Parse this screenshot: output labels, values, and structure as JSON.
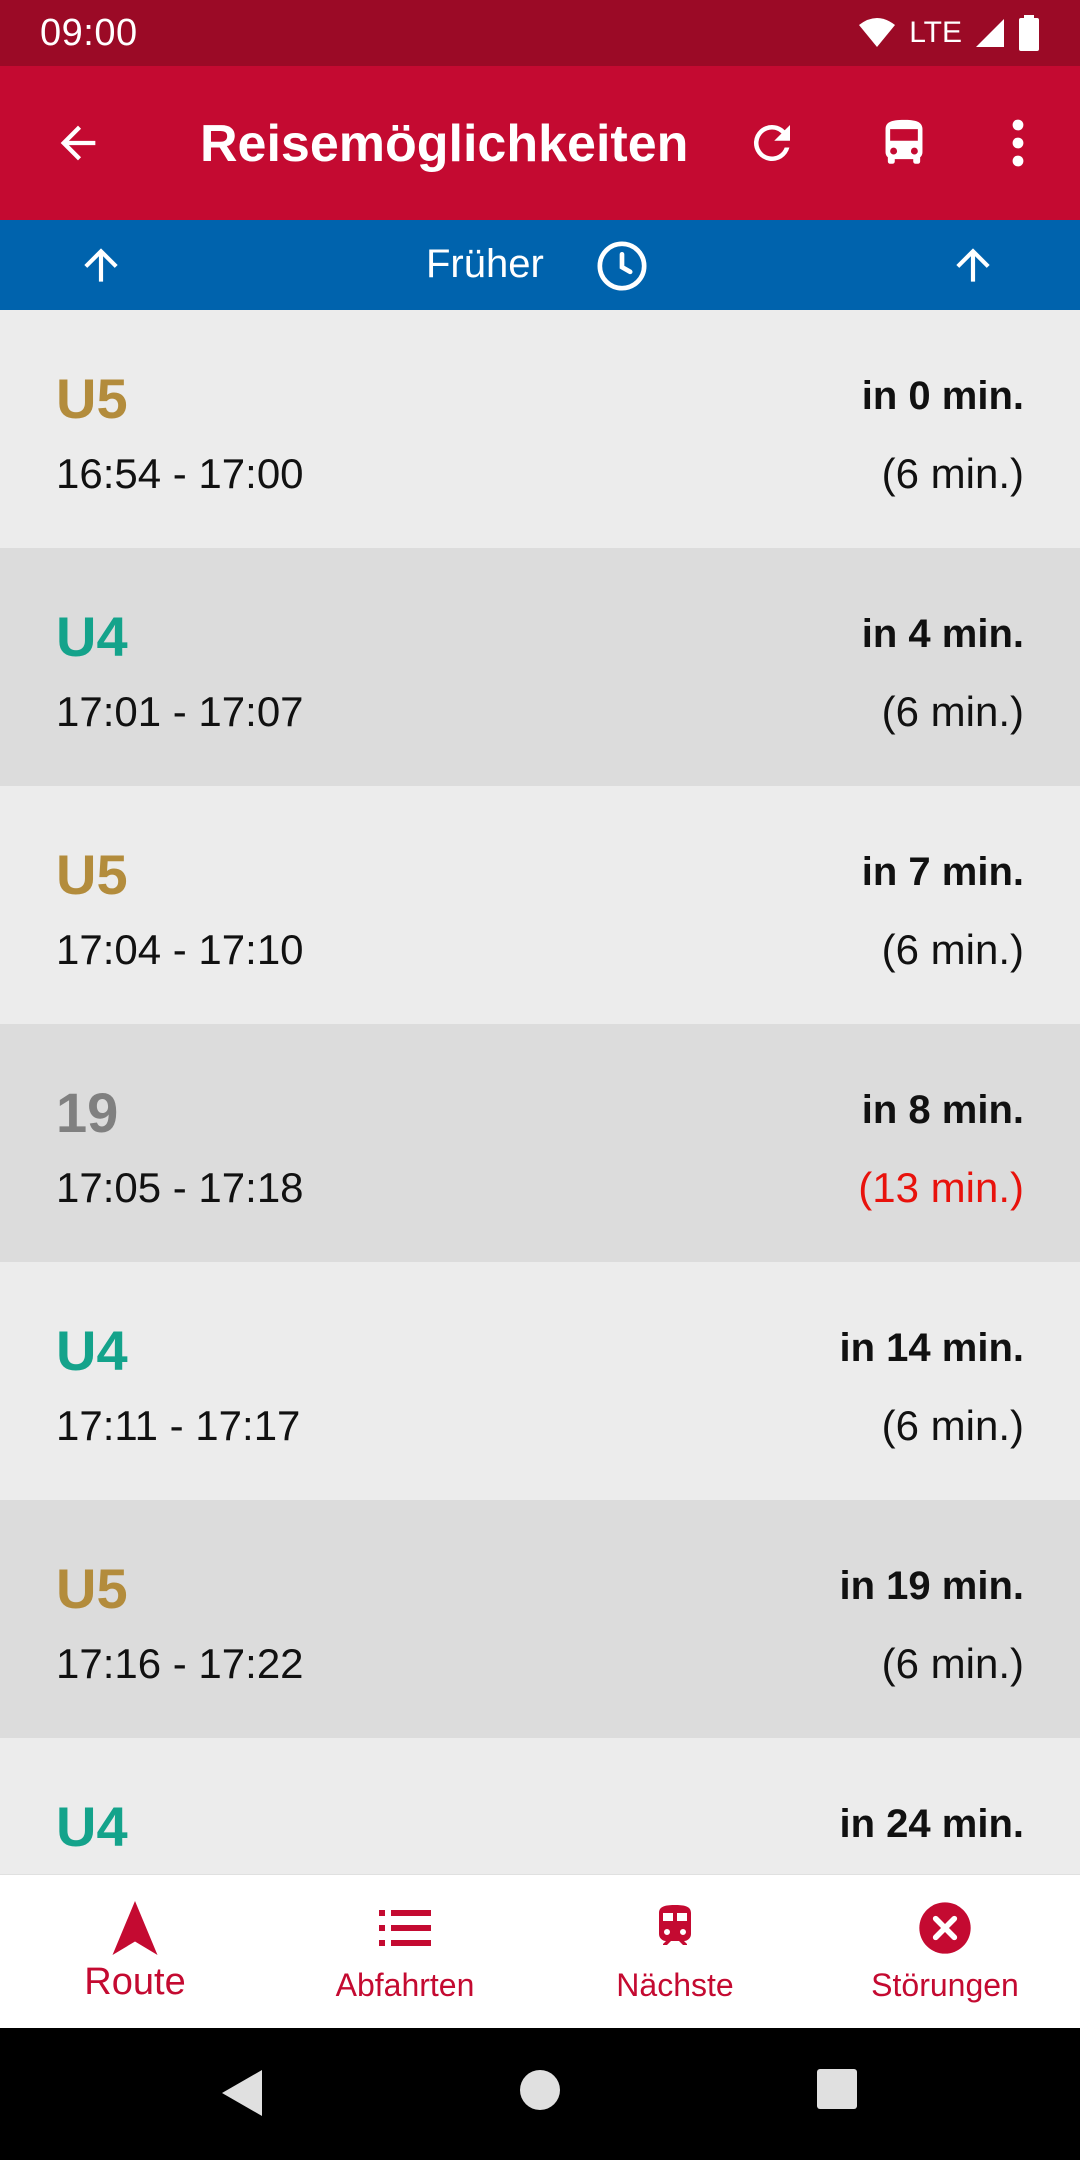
{
  "status_bar": {
    "time": "09:00",
    "network": "LTE"
  },
  "app_bar": {
    "title": "Reisemöglichkeiten",
    "back_icon": "arrow-back-icon",
    "refresh_icon": "refresh-icon",
    "bus_icon": "bus-icon",
    "more_icon": "more-vert-icon",
    "color": "#c40a31"
  },
  "nav_strip": {
    "label": "Früher",
    "color": "#0063ad"
  },
  "trips": [
    {
      "line": "U5",
      "line_color": "#b38c3c",
      "times": "16:54 - 17:00",
      "in": "in 0 min.",
      "duration": "(6 min.)",
      "duration_color": "#111111"
    },
    {
      "line": "U4",
      "line_color": "#14a38b",
      "times": "17:01 - 17:07",
      "in": "in 4 min.",
      "duration": "(6 min.)",
      "duration_color": "#111111"
    },
    {
      "line": "U5",
      "line_color": "#b38c3c",
      "times": "17:04 - 17:10",
      "in": "in 7 min.",
      "duration": "(6 min.)",
      "duration_color": "#111111"
    },
    {
      "line": "19",
      "line_color": "#808080",
      "times": "17:05 - 17:18",
      "in": "in 8 min.",
      "duration": "(13 min.)",
      "duration_color": "#e8120c"
    },
    {
      "line": "U4",
      "line_color": "#14a38b",
      "times": "17:11 - 17:17",
      "in": "in 14 min.",
      "duration": "(6 min.)",
      "duration_color": "#111111"
    },
    {
      "line": "U5",
      "line_color": "#b38c3c",
      "times": "17:16 - 17:22",
      "in": "in 19 min.",
      "duration": "(6 min.)",
      "duration_color": "#111111"
    },
    {
      "line": "U4",
      "line_color": "#14a38b",
      "times": "",
      "in": "in 24 min.",
      "duration": "",
      "duration_color": "#111111"
    }
  ],
  "bottom_nav": {
    "items": [
      {
        "label": "Route",
        "icon": "navigation-arrow-icon",
        "active": true
      },
      {
        "label": "Abfahrten",
        "icon": "list-icon",
        "active": false
      },
      {
        "label": "Nächste",
        "icon": "train-icon",
        "active": false
      },
      {
        "label": "Störungen",
        "icon": "cancel-circle-icon",
        "active": false
      }
    ]
  }
}
